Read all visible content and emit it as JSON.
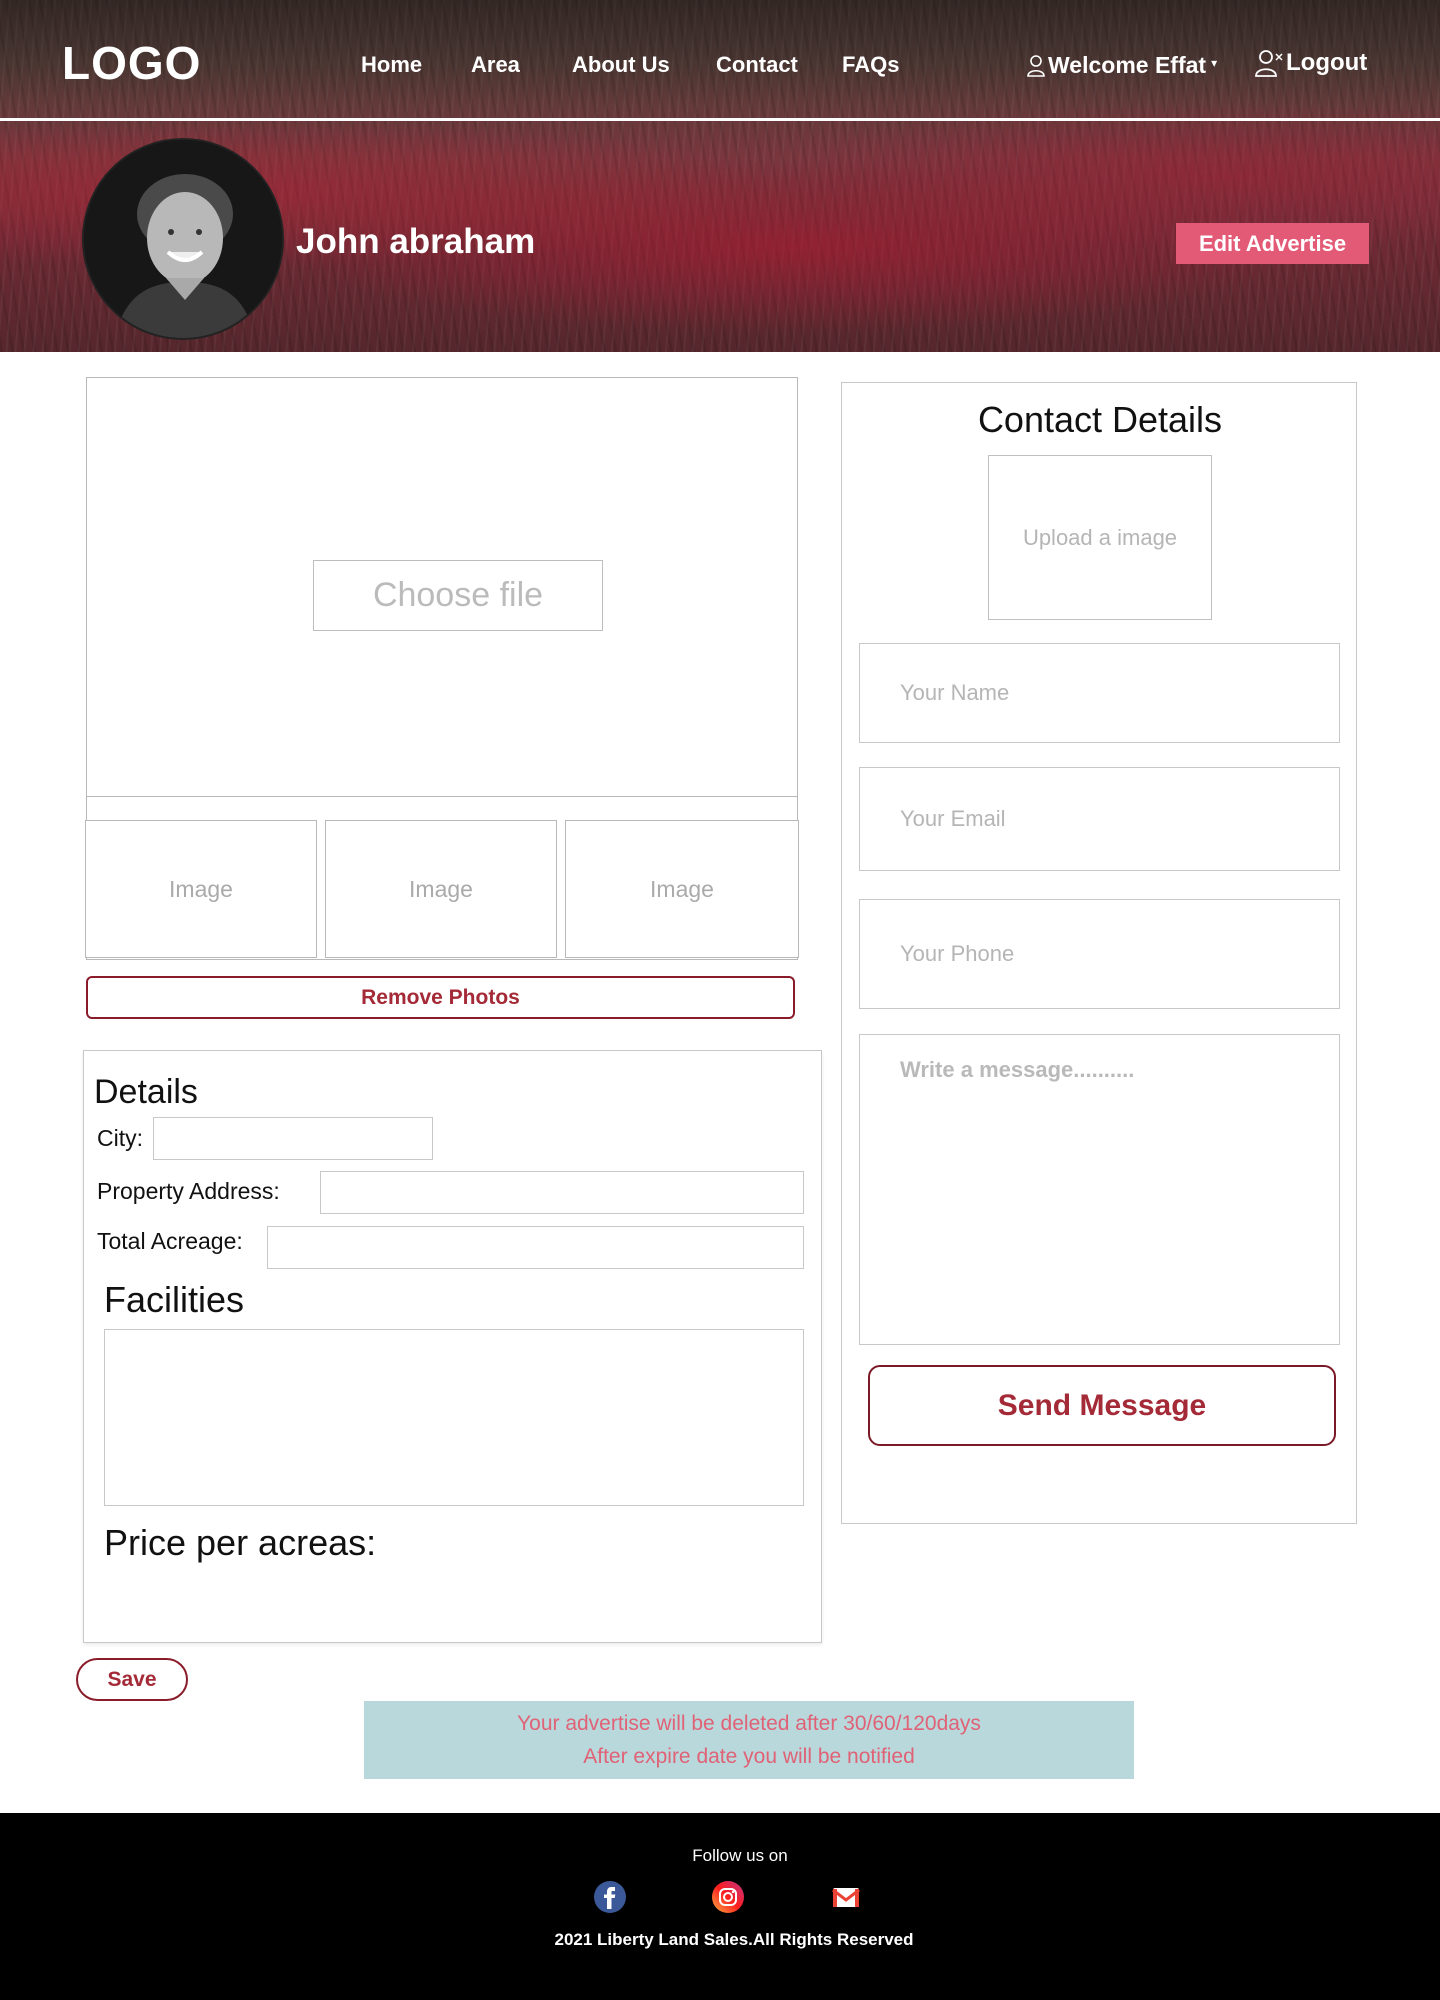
{
  "header": {
    "logo": "LOGO",
    "nav": [
      {
        "label": "Home"
      },
      {
        "label": "Area"
      },
      {
        "label": "About Us"
      },
      {
        "label": "Contact"
      },
      {
        "label": "FAQs"
      }
    ],
    "user_menu": {
      "label": "Welcome Effat",
      "icon": "user-icon"
    },
    "logout": {
      "label": "Logout",
      "icon": "user-logout-icon"
    }
  },
  "profile": {
    "name": "John abraham",
    "edit_button": "Edit Advertise"
  },
  "gallery": {
    "choose_file": "Choose file",
    "thumbnails": [
      "Image",
      "Image",
      "Image"
    ],
    "remove_button": "Remove Photos"
  },
  "details": {
    "title": "Details",
    "fields": {
      "city_label": "City:",
      "address_label": "Property Address:",
      "acreage_label": "Total Acreage:"
    },
    "facilities_title": "Facilities",
    "price_title": "Price per acreas:",
    "save_button": "Save"
  },
  "notice": {
    "line1": "Your advertise will be deleted after 30/60/120days",
    "line2": "After expire date you will be notified"
  },
  "contact": {
    "title": "Contact Details",
    "upload_image": "Upload a image",
    "name_placeholder": "Your Name",
    "email_placeholder": "Your Email",
    "phone_placeholder": "Your Phone",
    "message_placeholder": "Write a message..........",
    "send_button": "Send Message"
  },
  "footer": {
    "follow": "Follow us on",
    "socials": [
      "facebook-icon",
      "instagram-icon",
      "gmail-icon"
    ],
    "copyright": "2021  Liberty  Land Sales.All Rights Reserved"
  },
  "colors": {
    "accent": "#e35a76",
    "button_text": "#a32a36",
    "notice_bg": "#b9d8dc",
    "notice_text": "#e06276"
  }
}
